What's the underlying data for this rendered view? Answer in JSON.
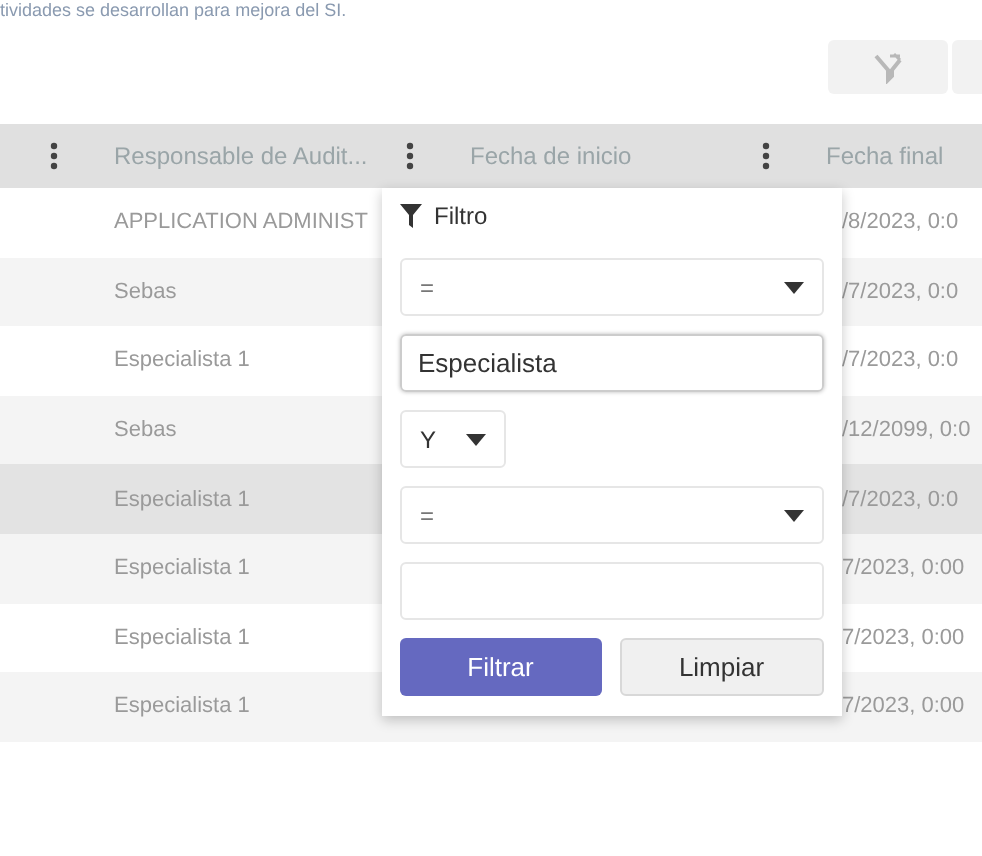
{
  "intro_text": "tividades se desarrollan para mejora del SI.",
  "table": {
    "columns": [
      {
        "label": "Responsable de Audit..."
      },
      {
        "label": "Fecha de inicio"
      },
      {
        "label": "Fecha final"
      }
    ],
    "rows": [
      {
        "responsable": "APPLICATION ADMINIST",
        "fecha_final": "/8/2023, 0:0",
        "hovered": false
      },
      {
        "responsable": "Sebas",
        "fecha_final": "/7/2023, 0:0",
        "hovered": false
      },
      {
        "responsable": "Especialista 1",
        "fecha_final": "/7/2023, 0:0",
        "hovered": false
      },
      {
        "responsable": "Sebas",
        "fecha_final": "/12/2099, 0:0",
        "hovered": false
      },
      {
        "responsable": "Especialista 1",
        "fecha_final": "/7/2023, 0:0",
        "hovered": true
      },
      {
        "responsable": "Especialista 1",
        "fecha_final": "7/2023, 0:00",
        "hovered": false
      },
      {
        "responsable": "Especialista 1",
        "fecha_final": "7/2023, 0:00",
        "hovered": false
      },
      {
        "responsable": "Especialista 1",
        "fecha_final": "7/2023, 0:00",
        "hovered": false
      }
    ]
  },
  "filter": {
    "title": "Filtro",
    "operator_1": "=",
    "value_1": "Especialista",
    "logic": "Y",
    "operator_2": "=",
    "buttons": [
      {
        "label": "Filtrar",
        "kind": "primary"
      },
      {
        "label": "Limpiar",
        "kind": "secondary"
      }
    ]
  }
}
